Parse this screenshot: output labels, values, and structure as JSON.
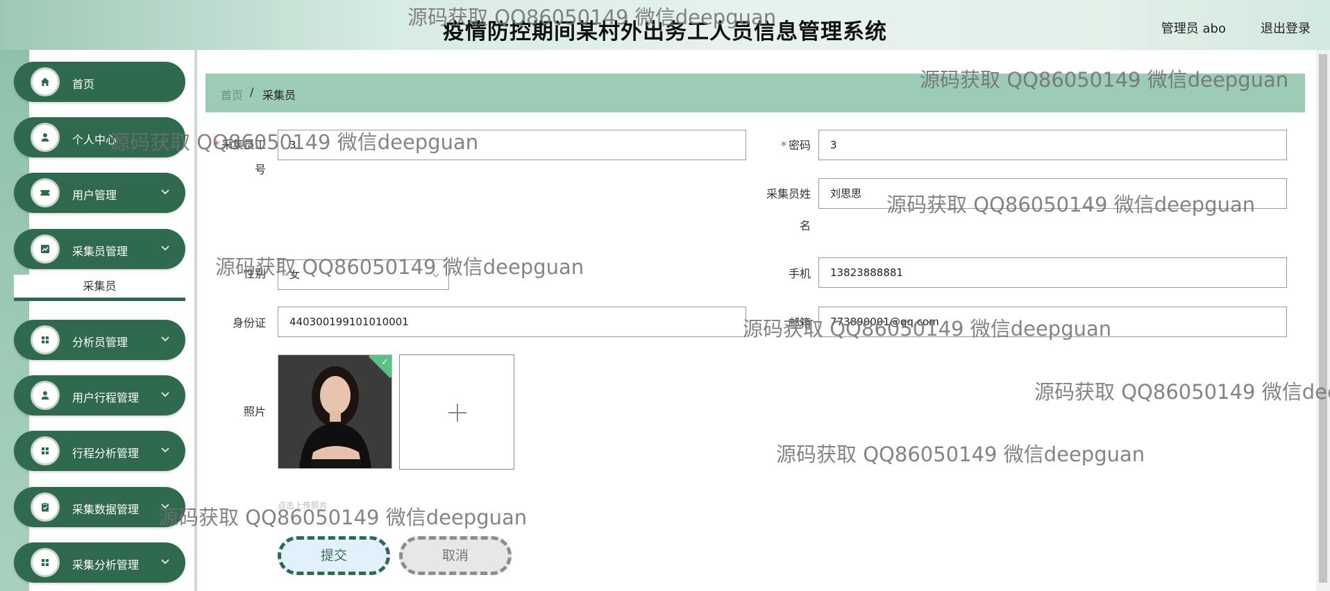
{
  "header": {
    "title": "疫情防控期间某村外出务工人员信息管理系统",
    "user_label": "管理员 abo",
    "logout_label": "退出登录"
  },
  "sidebar": {
    "items": [
      {
        "label": "首页",
        "icon": "home-icon",
        "has_arrow": false
      },
      {
        "label": "个人中心",
        "icon": "person-icon",
        "has_arrow": false
      },
      {
        "label": "用户管理",
        "icon": "ticket-icon",
        "has_arrow": true
      },
      {
        "label": "采集员管理",
        "icon": "chart-icon",
        "has_arrow": true
      },
      {
        "label": "分析员管理",
        "icon": "grid-icon",
        "has_arrow": true
      },
      {
        "label": "用户行程管理",
        "icon": "person-icon",
        "has_arrow": true
      },
      {
        "label": "行程分析管理",
        "icon": "grid-icon",
        "has_arrow": true
      },
      {
        "label": "采集数据管理",
        "icon": "clipboard-icon",
        "has_arrow": true
      },
      {
        "label": "采集分析管理",
        "icon": "grid-icon",
        "has_arrow": true
      }
    ],
    "sub_item": "采集员"
  },
  "breadcrumb": {
    "home": "首页",
    "separator": "/",
    "current": "采集员"
  },
  "form": {
    "collector_no_label_1": "采集员工",
    "collector_no_label_2": "号",
    "collector_no_value": "3",
    "password_label": "密码",
    "password_value": "3",
    "name_label_1": "采集员姓",
    "name_label_2": "名",
    "name_value": "刘思思",
    "gender_label": "性别",
    "gender_value": "女",
    "phone_label": "手机",
    "phone_value": "13823888881",
    "id_label": "身份证",
    "id_value": "440300199101010001",
    "email_label": "邮箱",
    "email_value": "773890001@qq.com",
    "photo_label": "照片",
    "upload_hint": "点击上传照片",
    "submit_label": "提交",
    "cancel_label": "取消"
  },
  "watermark": {
    "text": "源码获取 QQ86050149 微信deepguan"
  },
  "colors": {
    "primary": "#2f6a4e",
    "breadcrumb_bg": "#9ccbb6",
    "required": "#e03a3a"
  }
}
